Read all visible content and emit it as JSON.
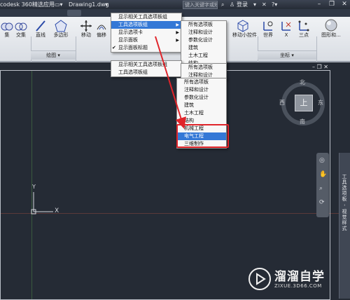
{
  "titlebar": {
    "app": "codesk 360",
    "menu_label": "精选应用",
    "drawing": "Drawing1.dwg",
    "search_placeholder": "键入关键字或短语",
    "signin": "登录"
  },
  "ribbon": {
    "buttons": {
      "merge": "集",
      "intersect": "交集",
      "line": "直线",
      "polygon": "多边形",
      "move": "移动",
      "offset": "偏移",
      "world": "世界",
      "x": "X",
      "threepoint": "三点",
      "gizmo": "移动小控件",
      "shapes": "图形和..."
    },
    "panels": {
      "draw": "绘图",
      "coords": "坐标"
    }
  },
  "menu_main": {
    "items": [
      {
        "label": "显示相关工具选项板组",
        "highlight": false,
        "arrow": false,
        "check": false
      },
      {
        "label": "工具选项板组",
        "highlight": true,
        "arrow": true,
        "check": false
      },
      {
        "label": "显示选项卡",
        "highlight": false,
        "arrow": true,
        "check": false
      },
      {
        "label": "显示面板",
        "highlight": false,
        "arrow": true,
        "check": false
      },
      {
        "label": "显示面板标题",
        "highlight": false,
        "arrow": false,
        "check": true
      }
    ]
  },
  "menu_sub1": {
    "items": [
      "所有选项板",
      "注释和设计",
      "参数化设计",
      "建筑",
      "土木工程",
      "结构"
    ]
  },
  "menu_main_echo": {
    "items": [
      "显示相关工具选项板组",
      "工具选项板组"
    ]
  },
  "menu_sub2": {
    "items": [
      {
        "label": "所有选项板",
        "highlight": false
      },
      {
        "label": "注释和设计",
        "highlight": false
      }
    ]
  },
  "menu_sub3": {
    "items": [
      {
        "label": "所有选项板",
        "highlight": false
      },
      {
        "label": "注释和设计",
        "highlight": false
      },
      {
        "label": "参数化设计",
        "highlight": false
      },
      {
        "label": "建筑",
        "highlight": false
      },
      {
        "label": "土木工程",
        "highlight": false
      },
      {
        "label": "结构",
        "highlight": false
      },
      {
        "label": "机械工程",
        "highlight": false
      },
      {
        "label": "电气工程",
        "highlight": true
      },
      {
        "label": "三维制作",
        "highlight": false
      }
    ]
  },
  "viewcube": {
    "north": "北",
    "south": "南",
    "east": "东",
    "west": "西",
    "face": "上"
  },
  "ucs": {
    "y": "Y",
    "x": "X"
  },
  "palette": {
    "title": "工具选项板 - 视觉样式"
  },
  "watermark": {
    "title": "溜溜自学",
    "url": "ZIXUE.3D66.COM"
  },
  "colors": {
    "highlight": "#3478d6",
    "redbox": "#e0242a",
    "arrow": "#e0242a"
  }
}
